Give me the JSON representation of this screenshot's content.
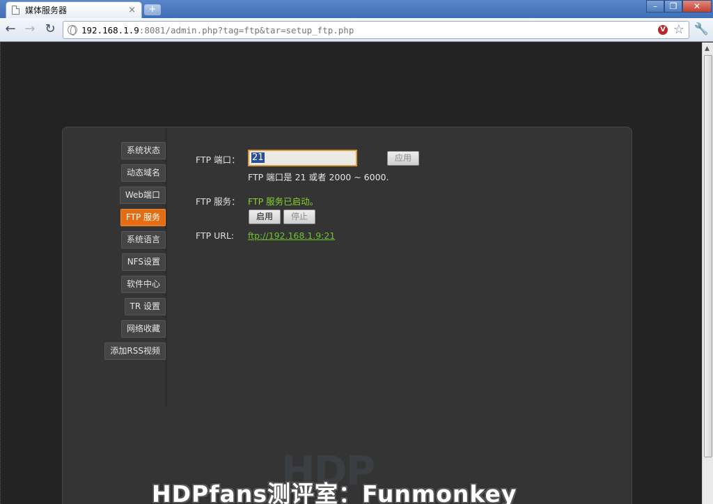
{
  "browser": {
    "tab_title": "媒体服务器",
    "tab_close": "×",
    "new_tab": "+",
    "url_host": "192.168.1.9",
    "url_rest": ":8081/admin.php?tag=ftp&tar=setup_ftp.php",
    "win_minimize": "–",
    "win_restore": "❐",
    "win_close": "✕"
  },
  "sidebar": {
    "items": [
      {
        "label": "系统状态",
        "active": false
      },
      {
        "label": "动态域名",
        "active": false
      },
      {
        "label": "Web端口",
        "active": false
      },
      {
        "label": "FTP 服务",
        "active": true
      },
      {
        "label": "系统语言",
        "active": false
      },
      {
        "label": "NFS设置",
        "active": false
      },
      {
        "label": "软件中心",
        "active": false
      },
      {
        "label": "TR 设置",
        "active": false
      },
      {
        "label": "网络收藏",
        "active": false
      },
      {
        "label": "添加RSS视频",
        "active": false
      }
    ]
  },
  "ftp": {
    "port_label": "FTP 端口：",
    "port_value": "21",
    "apply_label": "应用",
    "port_hint": "FTP 端口是 21 或者 2000 ~ 6000.",
    "service_label": "FTP 服务：",
    "service_status": "FTP 服务已启动。",
    "enable_label": "启用",
    "stop_label": "停止",
    "url_label": "FTP URL:",
    "url_value": "ftp://192.168.1.9:21"
  },
  "overlay": {
    "logo": "HDP",
    "watermark": "HDPfans测评室：Funmonkey"
  },
  "colors": {
    "accent_active": "#e36d12",
    "status_green": "#86d62c",
    "link_green": "#6cc52c"
  }
}
